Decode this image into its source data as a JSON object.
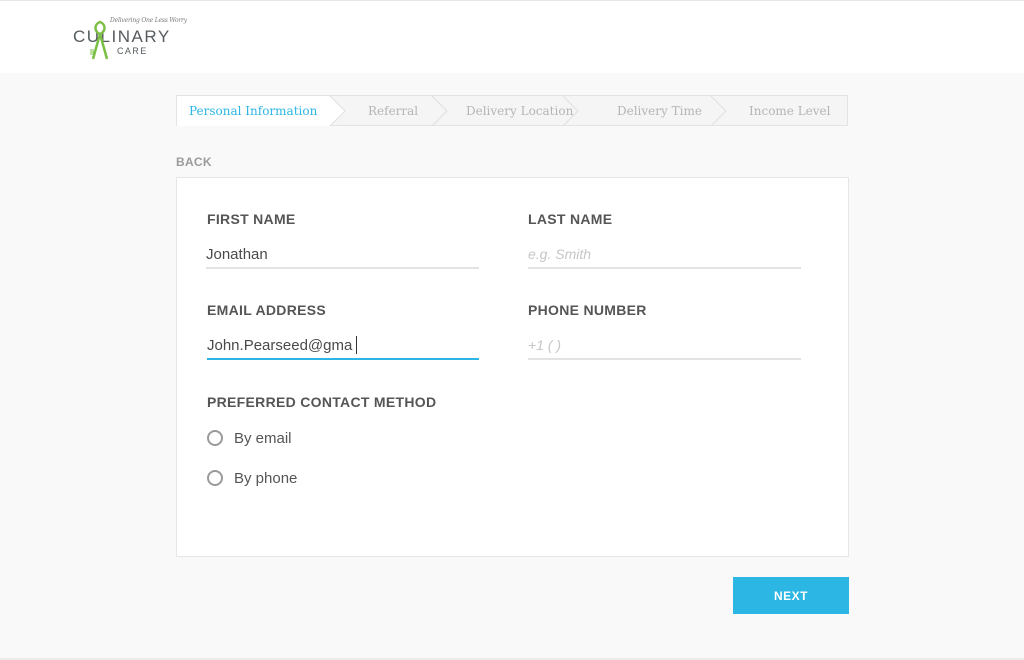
{
  "brand": {
    "tagline": "Delivering One Less Worry",
    "name": "CULINARY",
    "sub": "CARE",
    "accent_color": "#7cbf45"
  },
  "stepper": {
    "steps": [
      {
        "label": "Personal Information",
        "active": true
      },
      {
        "label": "Referral",
        "active": false
      },
      {
        "label": "Delivery Location",
        "active": false
      },
      {
        "label": "Delivery Time",
        "active": false
      },
      {
        "label": "Income Level",
        "active": false
      }
    ],
    "active_color": "#2cb6e3",
    "inactive_color": "#b5b5b5"
  },
  "nav": {
    "back_label": "BACK"
  },
  "form": {
    "first_name": {
      "label": "FIRST NAME",
      "value": "Jonathan",
      "placeholder": ""
    },
    "last_name": {
      "label": "LAST NAME",
      "value": "",
      "placeholder": "e.g. Smith"
    },
    "email": {
      "label": "EMAIL ADDRESS",
      "value": "John.Pearseed@gma",
      "placeholder": "",
      "focused": true
    },
    "phone": {
      "label": "PHONE NUMBER",
      "value": "",
      "placeholder": "+1 ( )"
    },
    "contact_method": {
      "label": "PREFERRED CONTACT METHOD",
      "options": [
        {
          "label": "By email",
          "selected": false
        },
        {
          "label": "By phone",
          "selected": false
        }
      ]
    }
  },
  "actions": {
    "next_label": "NEXT",
    "button_color": "#2cb6e3"
  }
}
